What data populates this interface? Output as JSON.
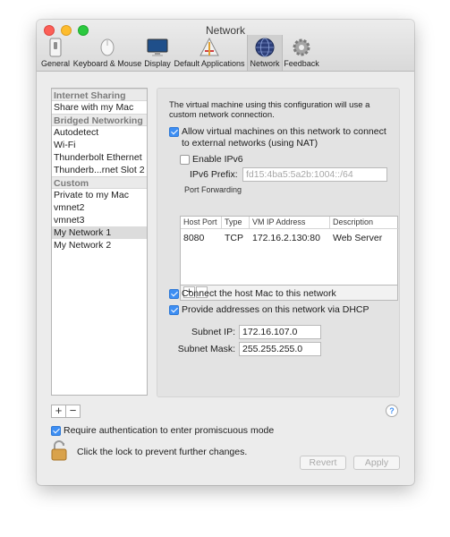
{
  "window": {
    "title": "Network"
  },
  "toolbar": [
    {
      "id": "general",
      "label": "General",
      "icon": "general-icon"
    },
    {
      "id": "keyboard-mouse",
      "label": "Keyboard & Mouse",
      "icon": "mouse-icon"
    },
    {
      "id": "display",
      "label": "Display",
      "icon": "display-icon"
    },
    {
      "id": "default-apps",
      "label": "Default Applications",
      "icon": "applications-icon"
    },
    {
      "id": "network",
      "label": "Network",
      "icon": "network-globe-icon",
      "selected": true
    },
    {
      "id": "feedback",
      "label": "Feedback",
      "icon": "feedback-gear-icon"
    }
  ],
  "sidebar": {
    "items": [
      {
        "label": "Internet Sharing",
        "header": true
      },
      {
        "label": "Share with my Mac"
      },
      {
        "label": "Bridged Networking",
        "header": true
      },
      {
        "label": "Autodetect"
      },
      {
        "label": "Wi-Fi"
      },
      {
        "label": "Thunderbolt Ethernet"
      },
      {
        "label": "Thunderb...rnet Slot 2"
      },
      {
        "label": "Custom",
        "header": true
      },
      {
        "label": "Private to my Mac"
      },
      {
        "label": "vmnet2"
      },
      {
        "label": "vmnet3"
      },
      {
        "label": "My Network 1",
        "selected": true
      },
      {
        "label": "My Network 2"
      }
    ],
    "add_label": "+",
    "remove_label": "−"
  },
  "panel": {
    "intro": "The virtual machine using this configuration will use a custom network connection.",
    "allow_nat": {
      "label": "Allow virtual machines on this network to connect to external networks (using NAT)",
      "checked": true
    },
    "enable_ipv6": {
      "label": "Enable IPv6",
      "checked": false
    },
    "ipv6_prefix": {
      "label": "IPv6 Prefix:",
      "placeholder": "fd15:4ba5:5a2b:1004::/64"
    },
    "port_forwarding": {
      "label": "Port Forwarding",
      "columns": [
        "Host Port",
        "Type",
        "VM IP Address",
        "Description"
      ],
      "rows": [
        {
          "host_port": "8080",
          "type": "TCP",
          "vm_ip": "172.16.2.130:80",
          "description": "Web Server"
        }
      ],
      "add_label": "+",
      "remove_label": "−"
    },
    "connect_host": {
      "label": "Connect the host Mac to this network",
      "checked": true
    },
    "dhcp": {
      "label": "Provide addresses on this network via DHCP",
      "checked": true
    },
    "subnet_ip": {
      "label": "Subnet IP:",
      "value": "172.16.107.0"
    },
    "subnet_mask": {
      "label": "Subnet Mask:",
      "value": "255.255.255.0"
    }
  },
  "help_label": "?",
  "footer": {
    "promiscuous": {
      "label": "Require authentication to enter promiscuous mode",
      "checked": true
    },
    "lock_text": "Click the lock to prevent further changes.",
    "revert_label": "Revert",
    "apply_label": "Apply"
  },
  "colors": {
    "accent": "#3d8ef3",
    "selection": "#dcdcdc",
    "window_bg": "#ececec"
  }
}
